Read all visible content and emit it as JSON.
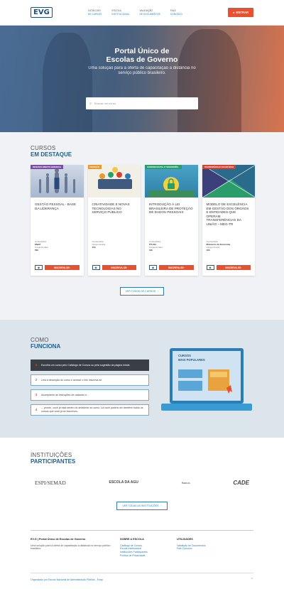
{
  "header": {
    "logo": "EVG",
    "nav": [
      {
        "top": "CATÁLOGO",
        "bottom": "DE CURSOS"
      },
      {
        "top": "ESCOLA",
        "bottom": "INSTITUCIONAL"
      },
      {
        "top": "VALIDAÇÃO",
        "bottom": "DE DOCUMENTOS"
      },
      {
        "top": "FALE",
        "bottom": "CONOSCO"
      }
    ],
    "enter_label": "ENTRAR"
  },
  "hero": {
    "title_line1": "Portal Único de",
    "title_line2": "Escolas de Governo",
    "subtitle_line1": "Uma solução para a oferta de capacitação a distância no",
    "subtitle_line2": "serviço público brasileiro.",
    "search_placeholder": "Buscar um curso"
  },
  "featured": {
    "title_line1": "CURSOS",
    "title_line2": "EM DESTAQUE",
    "content_label": "Conteudista",
    "hours_label": "Carga Horária",
    "subscribe_label": "INSCREVA-SE",
    "see_all_label": "VER TODOS OS CURSOS",
    "cards": [
      {
        "badge": "DESENVOLVIMENTO GERENCIAL",
        "badge_color": "#7a4ea0",
        "title": "GESTÃO PESSOAL - BASE DA LIDERANÇA",
        "author": "ENAP",
        "hours": "50h"
      },
      {
        "badge": "INOVAÇÃO",
        "badge_color": "#e89a2e",
        "title": "CRIATIVIDADE E NOVAS TECNOLOGIAS NO SERVIÇO PÚBLICO",
        "author": "",
        "hours": "10h"
      },
      {
        "badge": "GOVERNO DIGITAL E TRANSPARÊN...",
        "badge_color": "#2a9d6a",
        "title": "INTRODUÇÃO À LEI BRASILEIRA DE PROTEÇÃO DE DADOS PESSOAIS",
        "author": "ITS Rio",
        "hours": "10h"
      },
      {
        "badge": "TRANSFERÊNCIAS VOLUNTÁRIAS",
        "badge_color": "#d6402e",
        "title": "MODELO DE EXCELÊNCIA EM GESTÃO DOS ÓRGÃOS E ENTIDADES QUE OPERAM TRANSFERÊNCIAS DA UNIÃO – MEG-TR",
        "author": "Ministério da Economia",
        "hours": "10h"
      }
    ]
  },
  "how": {
    "title_line1": "COMO",
    "title_line2": "FUNCIONA",
    "steps": [
      {
        "num": "1",
        "text": "Escolha um curso pelo Catálogo de Cursos ou pela sugestão da página inicial."
      },
      {
        "num": "2",
        "text": "Leia a descrição do curso e acesse o link Inscreva-se."
      },
      {
        "num": "3",
        "text": "Acompanhe as instruções de cadastro e..."
      },
      {
        "num": "4",
        "text": "... pronto, você já está dentro do ambiente do curso. Lá você poderá ver também todos os cursos que você já se inscreveu."
      }
    ],
    "screen_title_line1": "CURSOS",
    "screen_title_line2": "MAIS POPULARES"
  },
  "institutions": {
    "title_line1": "INSTITUIÇÕES",
    "title_line2": "PARTICIPANTES",
    "logos": [
      "ESPI/SEMAD",
      "ESCOLA DA AGU",
      "Santos",
      "CADE"
    ],
    "see_all_label": "VER TODAS AS INSTITUIÇÕES"
  },
  "footer": {
    "brand": "EV.G | Portal Único de Escolas de Governo",
    "brand_desc": "Uma solução para a oferta de capacitação a distância no serviço público brasileiro.",
    "col1_title": "SOBRE A ESCOLA",
    "col1_links": [
      "Catálogo de Cursos",
      "Escola Institucional",
      "Instituições Participantes",
      "Política de Privacidade"
    ],
    "col2_title": "UTILIDADES",
    "col2_links": [
      "Validação de Documentos",
      "Fale Conosco"
    ],
    "bottom_text": "Organizado por Escola Nacional de Administração Pública - Enap",
    "accent": "#e8502e",
    "primary": "#1f5f8b"
  }
}
